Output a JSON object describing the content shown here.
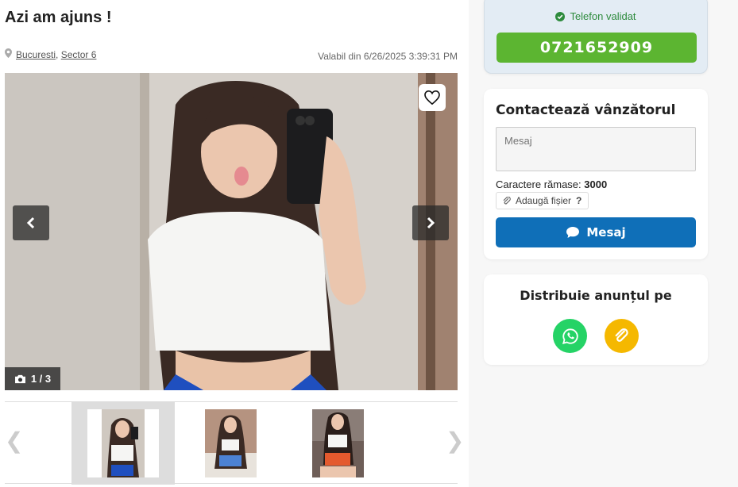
{
  "listing": {
    "title": "Azi am ajuns !",
    "location_city": "Bucuresti",
    "location_sep": ",",
    "location_sector": "Sector 6",
    "valid_since": "Valabil din 6/26/2025 3:39:31 PM"
  },
  "gallery": {
    "counter": "1 / 3",
    "prev_arrow": "‹",
    "next_arrow": "›",
    "thumb_prev": "❮",
    "thumb_next": "❯"
  },
  "phone": {
    "validated_label": "Telefon validat",
    "number": "0721652909"
  },
  "contact": {
    "title": "Contactează vânzătorul",
    "message_placeholder": "Mesaj",
    "chars_label": "Caractere rămase:",
    "chars_value": "3000",
    "attach_label": "Adaugă fișier",
    "attach_help": "?",
    "send_label": "Mesaj"
  },
  "share": {
    "title": "Distribuie anunțul pe"
  },
  "colors": {
    "phone_green": "#5cb531",
    "send_blue": "#0f6fb8",
    "whatsapp": "#25d366",
    "copy_link": "#f5b800"
  }
}
